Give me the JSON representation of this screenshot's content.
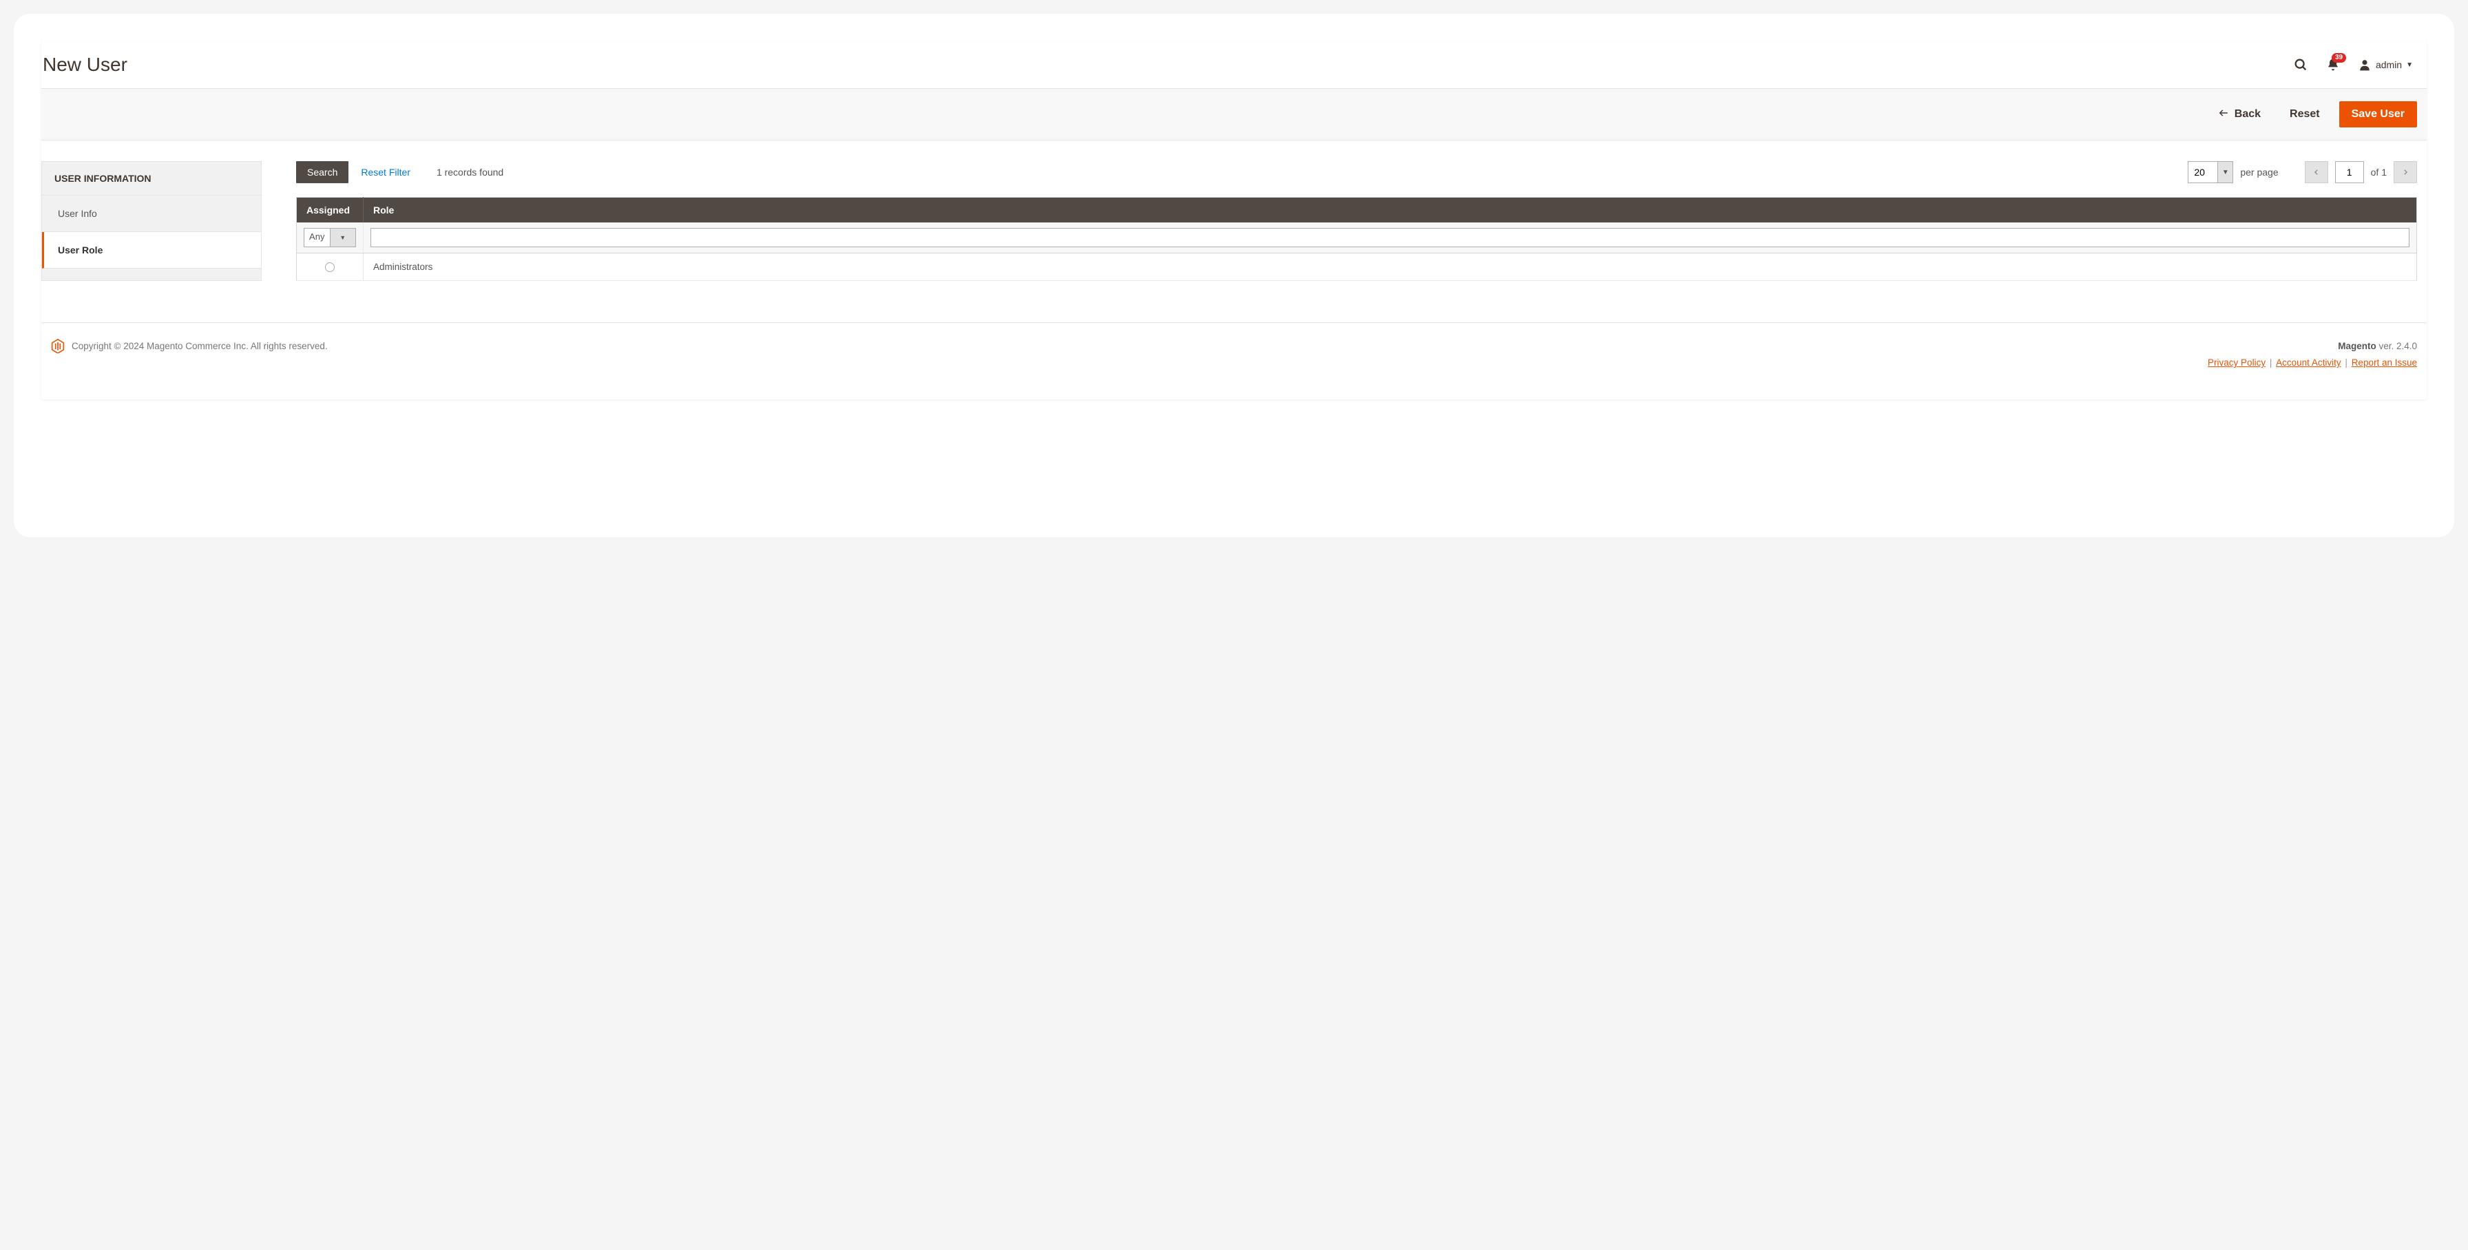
{
  "header": {
    "title": "New User",
    "notif_count": "39",
    "user_name": "admin"
  },
  "actions": {
    "back": "Back",
    "reset": "Reset",
    "save": "Save User"
  },
  "sidebar": {
    "heading": "USER INFORMATION",
    "tabs": [
      {
        "label": "User Info",
        "active": false
      },
      {
        "label": "User Role",
        "active": true
      }
    ]
  },
  "grid": {
    "search_btn": "Search",
    "reset_filter": "Reset Filter",
    "records_found": "1 records found",
    "per_page_value": "20",
    "per_page_label": "per page",
    "page_current": "1",
    "page_of_label": "of 1",
    "columns": {
      "assigned": "Assigned",
      "role": "Role"
    },
    "filter_assigned_value": "Any",
    "filter_role_value": "",
    "rows": [
      {
        "assigned": false,
        "role": "Administrators"
      }
    ]
  },
  "footer": {
    "copyright": "Copyright © 2024 Magento Commerce Inc. All rights reserved.",
    "product": "Magento",
    "version": " ver. 2.4.0",
    "links": {
      "privacy": "Privacy Policy",
      "activity": " Account Activity",
      "report": "Report an Issue"
    }
  }
}
